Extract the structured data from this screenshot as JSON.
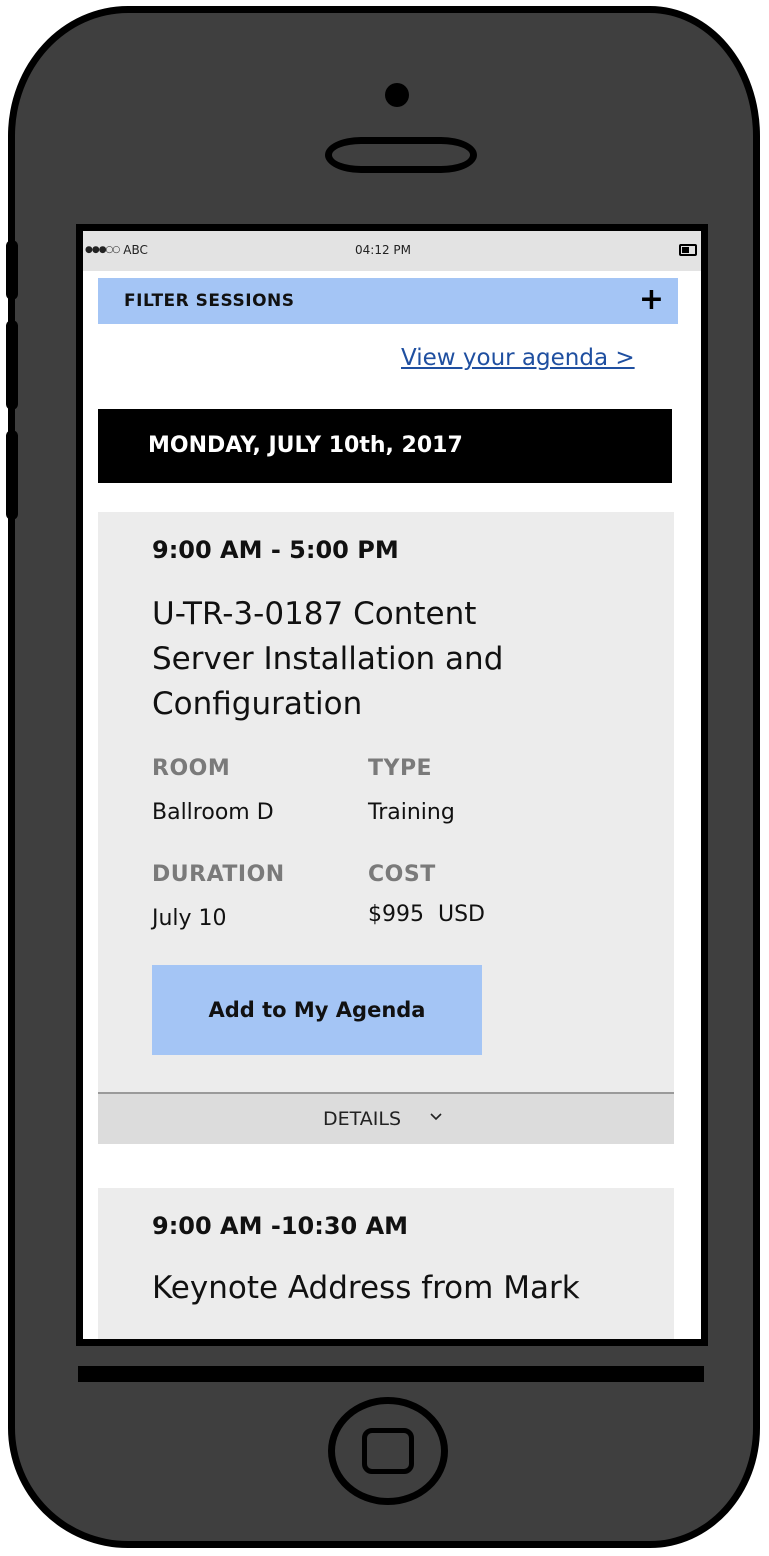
{
  "status_bar": {
    "carrier": "ABC",
    "signal_icon": "signal-dots-icon",
    "time": "04:12 PM",
    "battery_icon": "battery-icon"
  },
  "filter": {
    "label": "FILTER SESSIONS",
    "icon": "plus-icon",
    "color": "#a4c5f5"
  },
  "agenda_link": "View your agenda >",
  "day_header": "MONDAY, JULY 10th, 2017",
  "sessions": [
    {
      "time": "9:00 AM - 5:00 PM",
      "title_lines": [
        "U-TR-3-0187 Content",
        "Server Installation and",
        "Configuration"
      ],
      "room_label": "ROOM",
      "room": "Ballroom D",
      "type_label": "TYPE",
      "type": "Training",
      "duration_label": "DURATION",
      "duration": "July 10",
      "cost_label": "COST",
      "cost": "$995  USD",
      "add_button": "Add to My Agenda",
      "details_label": "DETAILS"
    },
    {
      "time": "9:00 AM -10:30 AM",
      "title_lines": [
        "Keynote Address from Mark"
      ]
    }
  ]
}
